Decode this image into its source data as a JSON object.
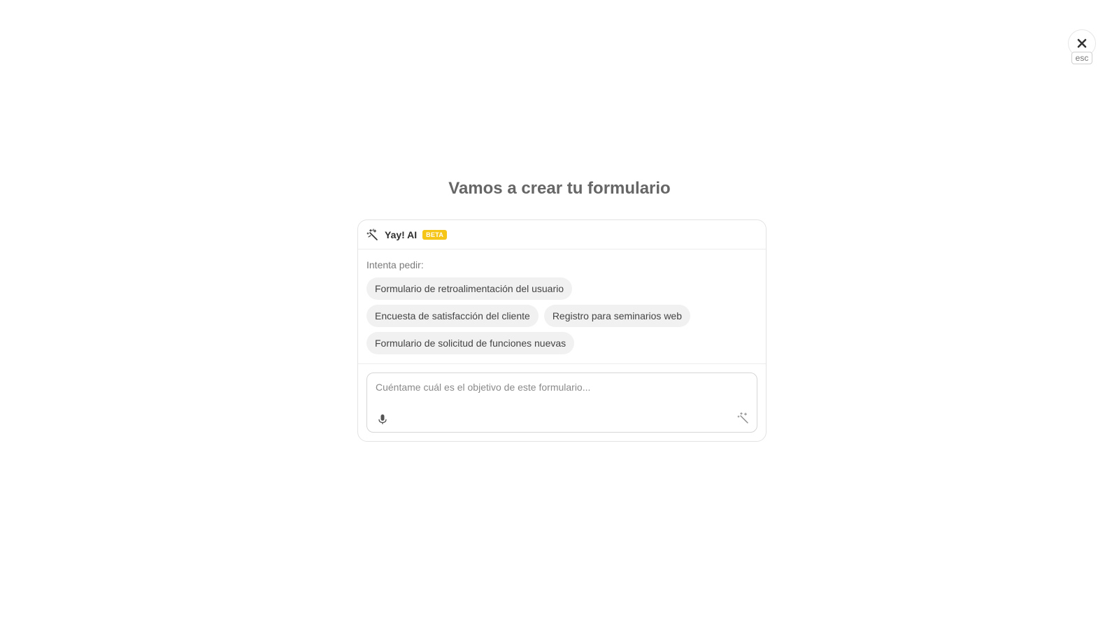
{
  "close": {
    "esc_label": "esc"
  },
  "page": {
    "title": "Vamos a crear tu formulario"
  },
  "assistant": {
    "name": "Yay! AI",
    "badge": "BETA",
    "badge_color": "#f5c518",
    "icon": "magic-wand-icon"
  },
  "suggestions": {
    "label": "Intenta pedir:",
    "items": [
      "Formulario de retroalimentación del usuario",
      "Encuesta de satisfacción del cliente",
      "Registro para seminarios web",
      "Formulario de solicitud de funciones nuevas"
    ]
  },
  "prompt": {
    "placeholder": "Cuéntame cuál es el objetivo de este formulario...",
    "value": ""
  }
}
